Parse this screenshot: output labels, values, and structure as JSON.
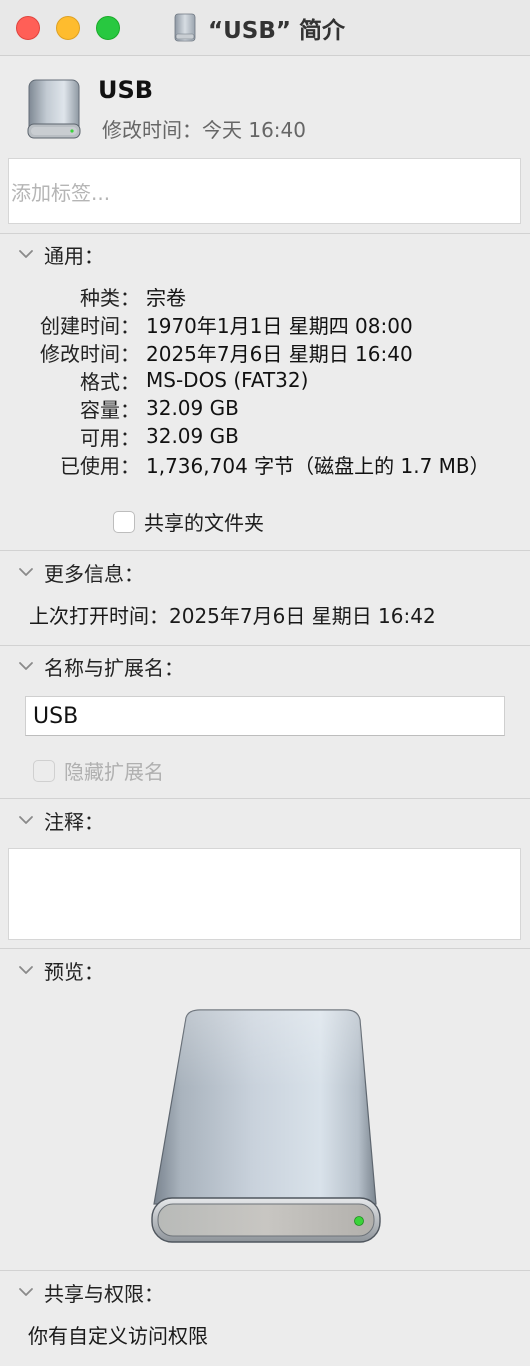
{
  "window": {
    "title": "“USB” 简介"
  },
  "header": {
    "name": "USB",
    "modified": "修改时间：今天 16:40",
    "icon": "external-drive-icon"
  },
  "tags": {
    "placeholder": "添加标签..."
  },
  "general": {
    "title": "通用：",
    "rows": [
      {
        "label": "种类：",
        "value": "宗卷"
      },
      {
        "label": "创建时间：",
        "value": "1970年1月1日 星期四 08:00"
      },
      {
        "label": "修改时间：",
        "value": "2025年7月6日 星期日 16:40"
      },
      {
        "label": "格式：",
        "value": "MS-DOS (FAT32)"
      },
      {
        "label": "容量：",
        "value": "32.09 GB"
      },
      {
        "label": "可用：",
        "value": "32.09 GB"
      },
      {
        "label": "已使用：",
        "value": "1,736,704 字节（磁盘上的 1.7 MB）"
      }
    ],
    "shared_folder_label": "共享的文件夹"
  },
  "more_info": {
    "title": "更多信息：",
    "last_opened": "上次打开时间：2025年7月6日 星期日 16:42"
  },
  "name_ext": {
    "title": "名称与扩展名：",
    "value": "USB",
    "hide_ext_label": "隐藏扩展名"
  },
  "comments": {
    "title": "注释："
  },
  "preview": {
    "title": "预览：",
    "icon": "external-drive-icon"
  },
  "sharing": {
    "title": "共享与权限：",
    "text": "你有自定义访问权限"
  },
  "colors": {
    "close": "#ff5f57",
    "minimize": "#febc2e",
    "zoom": "#28c840",
    "drive_led": "#3ad33a"
  }
}
